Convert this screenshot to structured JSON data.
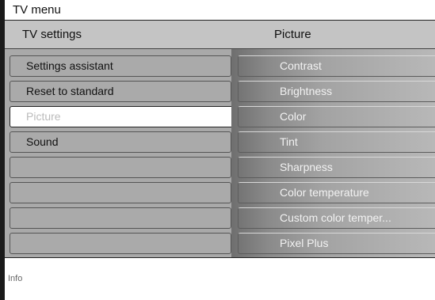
{
  "window": {
    "title": "TV menu"
  },
  "header": {
    "left_title": "TV settings",
    "right_title": "Picture"
  },
  "menu": {
    "items": [
      {
        "label": "Settings assistant"
      },
      {
        "label": "Reset to standard"
      },
      {
        "label": "Picture",
        "selected": true
      },
      {
        "label": "Sound"
      },
      {
        "label": ""
      },
      {
        "label": ""
      },
      {
        "label": ""
      },
      {
        "label": ""
      }
    ]
  },
  "submenu": {
    "items": [
      {
        "label": "Contrast"
      },
      {
        "label": "Brightness"
      },
      {
        "label": "Color"
      },
      {
        "label": "Tint"
      },
      {
        "label": "Sharpness"
      },
      {
        "label": "Color temperature"
      },
      {
        "label": "Custom color temper..."
      },
      {
        "label": "Pixel Plus"
      }
    ]
  },
  "info": {
    "label": "Info"
  }
}
